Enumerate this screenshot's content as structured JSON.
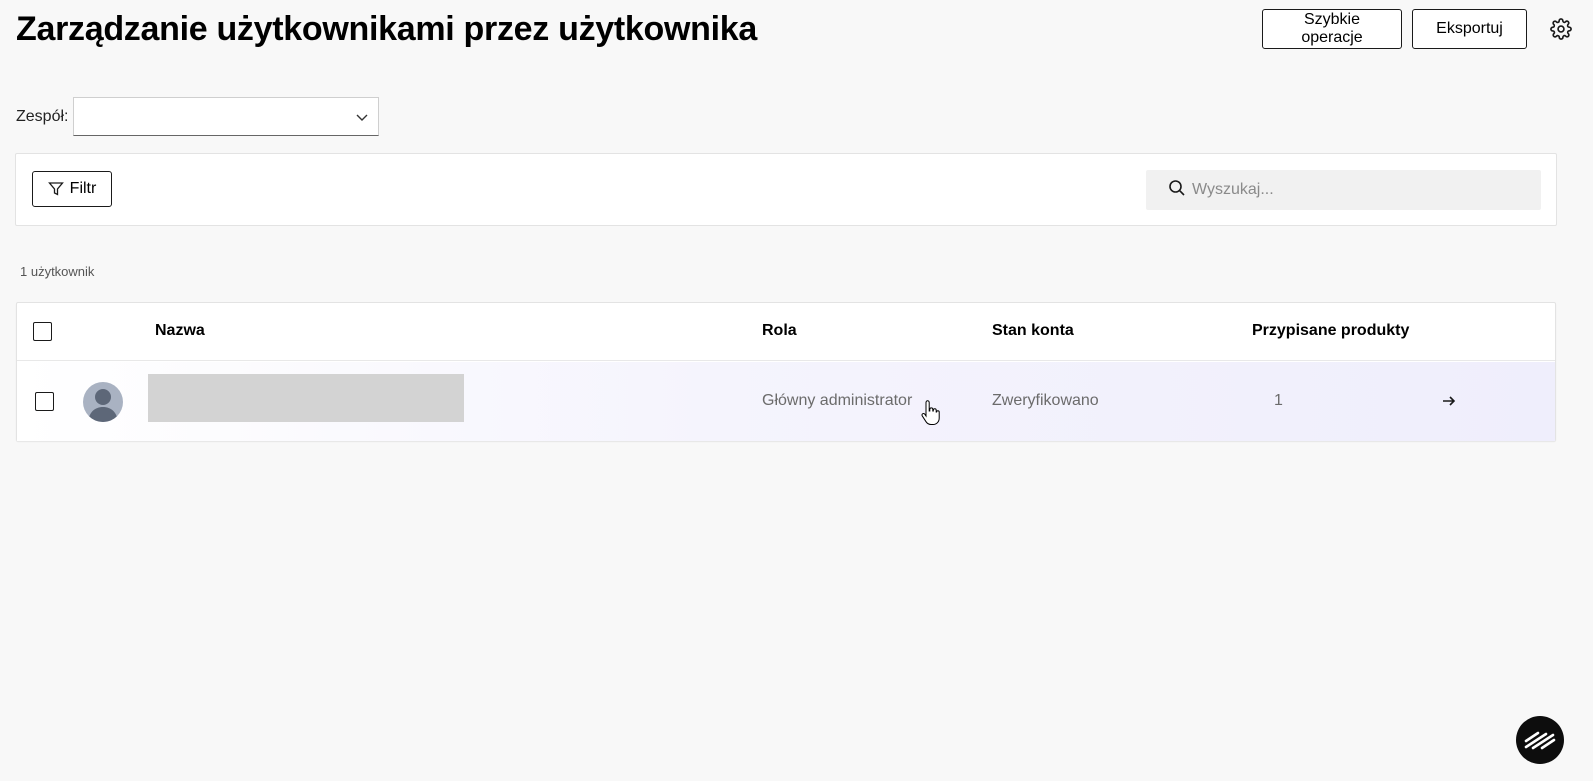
{
  "header": {
    "title": "Zarządzanie użytkownikami przez użytkownika",
    "quick_ops_label": "Szybkie operacje",
    "export_label": "Eksportuj",
    "settings_icon": "gear-icon"
  },
  "team_filter": {
    "label": "Zespół:",
    "selected": ""
  },
  "toolbar": {
    "filter_label": "Filtr",
    "search_placeholder": "Wyszukaj..."
  },
  "user_count": "1 użytkownik",
  "table": {
    "columns": {
      "name": "Nazwa",
      "role": "Rola",
      "status": "Stan konta",
      "products": "Przypisane produkty"
    },
    "rows": [
      {
        "name": "",
        "role": "Główny administrator",
        "status": "Zweryfikowano",
        "products": "1"
      }
    ]
  },
  "colors": {
    "background": "#f8f8f8",
    "row_highlight": "#efeefc",
    "border": "#1a1a1a"
  }
}
